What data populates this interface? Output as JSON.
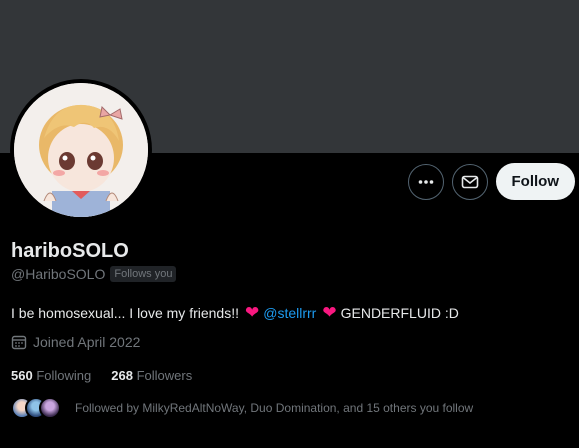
{
  "profile": {
    "display_name": "hariboSOLO",
    "handle": "@HariboSOLO",
    "follows_you": "Follows you",
    "bio_text1": "I be homosexual... I love my friends!!",
    "bio_mention": "@stellrrr",
    "bio_text2": "GENDERFLUID :D",
    "joined": "Joined April 2022",
    "following_count": "560",
    "following_label": "Following",
    "followers_count": "268",
    "followers_label": "Followers",
    "followed_by": "Followed by MilkyRedAltNoWay, Duo Domination, and 15 others you follow"
  },
  "actions": {
    "follow_label": "Follow",
    "more_icon": "more-icon",
    "message_icon": "envelope-icon"
  },
  "colors": {
    "banner": "#333639",
    "accent": "#1d9bf0",
    "heart": "#f91880"
  }
}
